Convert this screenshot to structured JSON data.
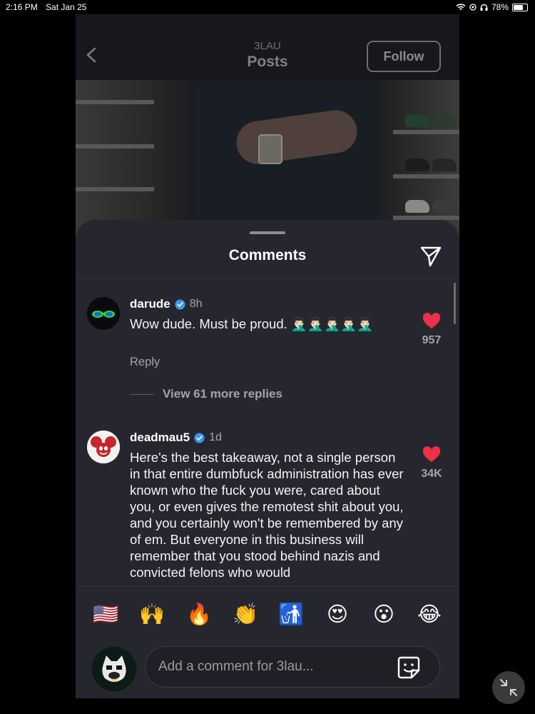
{
  "status_bar": {
    "time": "2:16 PM",
    "date": "Sat Jan 25",
    "battery": "78%"
  },
  "nav": {
    "subtitle": "3LAU",
    "title": "Posts",
    "follow_label": "Follow"
  },
  "comments_sheet": {
    "title": "Comments",
    "comments": [
      {
        "username": "darude",
        "time": "8h",
        "text": "Wow dude. Must be proud. 🤦🏻‍♂️🤦🏻‍♂️🤦🏻‍♂️🤦🏻‍♂️🤦🏻‍♂️",
        "reply_label": "Reply",
        "likes": "957",
        "view_more": "View 61 more replies"
      },
      {
        "username": "deadmau5",
        "time": "1d",
        "text": "Here's the best takeaway, not a single person in that entire dumbfuck administration has ever known who the fuck you were, cared about you, or even gives the remotest shit about you, and you certainly won't be remembered by any of em.  But everyone in this business will remember that you stood behind nazis and convicted felons who would",
        "likes": "34K"
      }
    ],
    "reactions": [
      "🇺🇸",
      "🙌",
      "🔥",
      "👏",
      "🚮",
      "😍",
      "😮",
      "😂"
    ],
    "composer": {
      "placeholder": "Add a comment for 3lau..."
    }
  },
  "colors": {
    "heart": "#ed2f47",
    "verified": "#3897f0",
    "sheet": "#26272e"
  }
}
